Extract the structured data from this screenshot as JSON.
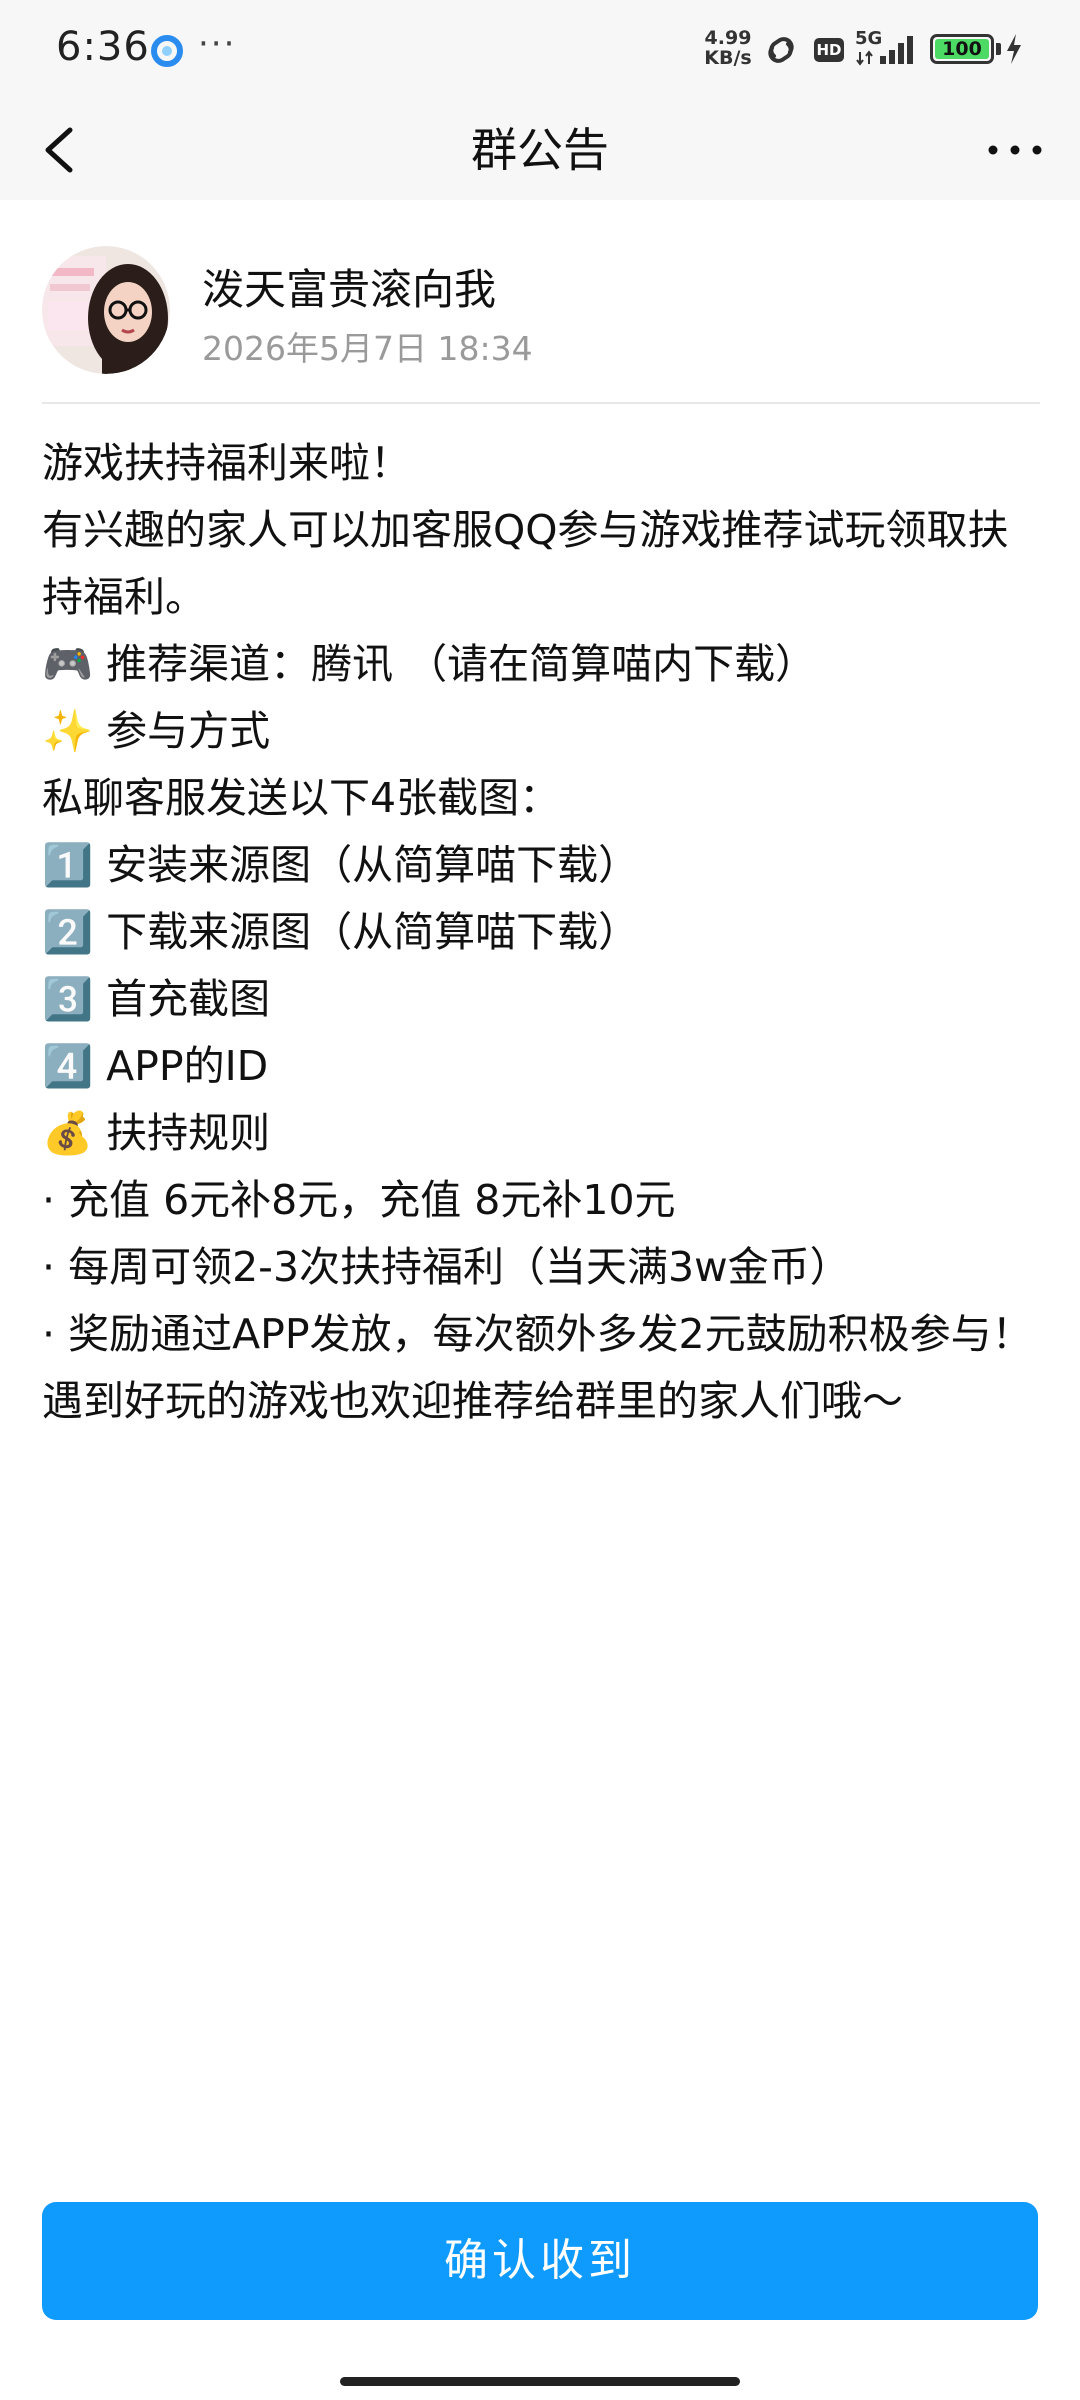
{
  "status_bar": {
    "time": "6:36",
    "dots": "···",
    "net_speed_value": "4.99",
    "net_speed_unit": "KB/s",
    "hd_label": "HD",
    "network_type": "5G",
    "battery_level": "100",
    "icons": [
      "app-notification-icon",
      "link-icon",
      "hd-icon",
      "signal-icon",
      "battery-icon",
      "charging-icon"
    ]
  },
  "nav": {
    "title": "群公告",
    "back_icon": "chevron-left-icon",
    "more_icon": "more-horizontal-icon"
  },
  "author": {
    "name": "泼天富贵滚向我",
    "time": "2026年5月7日 18:34"
  },
  "content": {
    "lines": [
      "游戏扶持福利来啦！",
      "有兴趣的家人可以加客服QQ参与游戏推荐试玩领取扶持福利。",
      "🎮 推荐渠道：腾讯 （请在简算喵内下载）",
      "✨ 参与方式",
      "私聊客服发送以下4张截图：",
      "1️⃣ 安装来源图（从简算喵下载）",
      "2️⃣ 下载来源图（从简算喵下载）",
      "3️⃣ 首充截图",
      "4️⃣ APP的ID",
      "💰 扶持规则",
      "· 充值 6元补8元，充值 8元补10元",
      "· 每周可领2-3次扶持福利（当天满3w金币）",
      "· 奖励通过APP发放，每次额外多发2元鼓励积极参与！",
      "遇到好玩的游戏也欢迎推荐给群里的家人们哦～"
    ]
  },
  "actions": {
    "confirm_label": "确认收到"
  },
  "colors": {
    "accent": "#0f9bfd",
    "background": "#ffffff",
    "header_bg": "#f7f7f7",
    "muted_text": "#9a9a9a",
    "battery_fill": "#4cd964"
  }
}
